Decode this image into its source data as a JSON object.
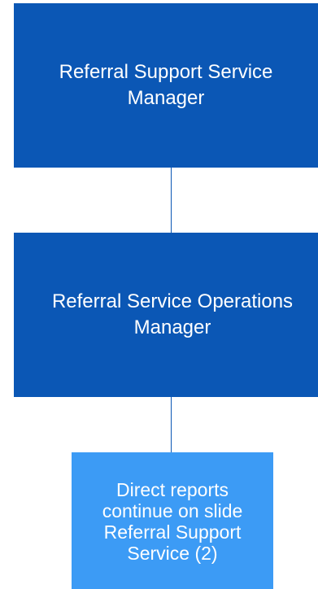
{
  "nodes": {
    "top": {
      "label": "Referral Support Service\nManager"
    },
    "middle": {
      "label": "Referral Service Operations\nManager"
    },
    "bottom": {
      "label": "Direct reports\ncontinue on slide\nReferral Support\nService (2)"
    }
  },
  "colors": {
    "primary_box": "#0b57b5",
    "secondary_box": "#3c9bf5",
    "text": "#ffffff",
    "connector": "#0b57b5"
  }
}
